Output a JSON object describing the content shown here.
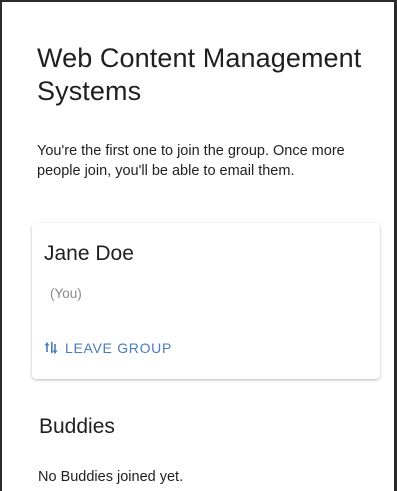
{
  "page": {
    "title": "Web Content Management Systems",
    "intro": "You're the first one to join the group. Once more people join, you'll be able to email them."
  },
  "member_card": {
    "name": "Jane Doe",
    "note": "(You)",
    "leave_label": "LEAVE GROUP",
    "leave_icon": "leave-group-icon",
    "accent": "#4a7bb7"
  },
  "buddies": {
    "title": "Buddies",
    "empty_message": "No Buddies joined yet."
  }
}
